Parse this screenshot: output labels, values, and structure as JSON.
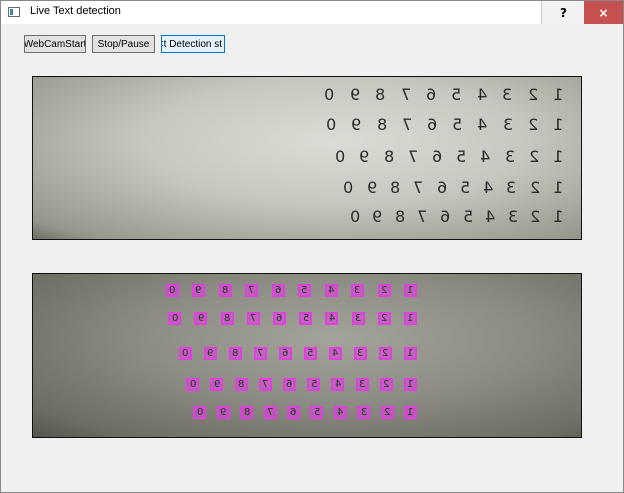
{
  "window": {
    "title": "Live Text detection",
    "help_label": "?",
    "close_label": "×"
  },
  "toolbar": {
    "webcam_start_label": "WebCamStart",
    "stop_pause_label": "Stop/Pause",
    "detection_label": "<t Detection st"
  },
  "camera_view": {
    "rows": [
      [
        "1",
        "2",
        "3",
        "4",
        "5",
        "6",
        "7",
        "8",
        "9",
        "0"
      ],
      [
        "1",
        "2",
        "3",
        "4",
        "5",
        "6",
        "7",
        "8",
        "9",
        "0"
      ],
      [
        "1",
        "2",
        "3",
        "4",
        "5",
        "6",
        "7",
        "8",
        "9",
        "0"
      ],
      [
        "1",
        "2",
        "3",
        "4",
        "5",
        "6",
        "7",
        "8",
        "9",
        "0"
      ],
      [
        "1",
        "2",
        "3",
        "4",
        "5",
        "6",
        "7",
        "8",
        "9",
        "0"
      ]
    ]
  },
  "detection_view": {
    "rows": [
      [
        "1",
        "2",
        "3",
        "4",
        "5",
        "6",
        "7",
        "8",
        "9",
        "0"
      ],
      [
        "1",
        "2",
        "3",
        "4",
        "5",
        "6",
        "7",
        "8",
        "9",
        "0"
      ],
      [
        "1",
        "2",
        "3",
        "4",
        "5",
        "6",
        "7",
        "8",
        "9",
        "0"
      ],
      [
        "1",
        "2",
        "3",
        "4",
        "5",
        "6",
        "7",
        "8",
        "9",
        "0"
      ],
      [
        "1",
        "2",
        "3",
        "4",
        "5",
        "6",
        "7",
        "8",
        "9",
        "0"
      ]
    ],
    "box_color": "#e040e0"
  },
  "colors": {
    "close_button": "#c75050",
    "active_button_border": "#0078d7"
  }
}
